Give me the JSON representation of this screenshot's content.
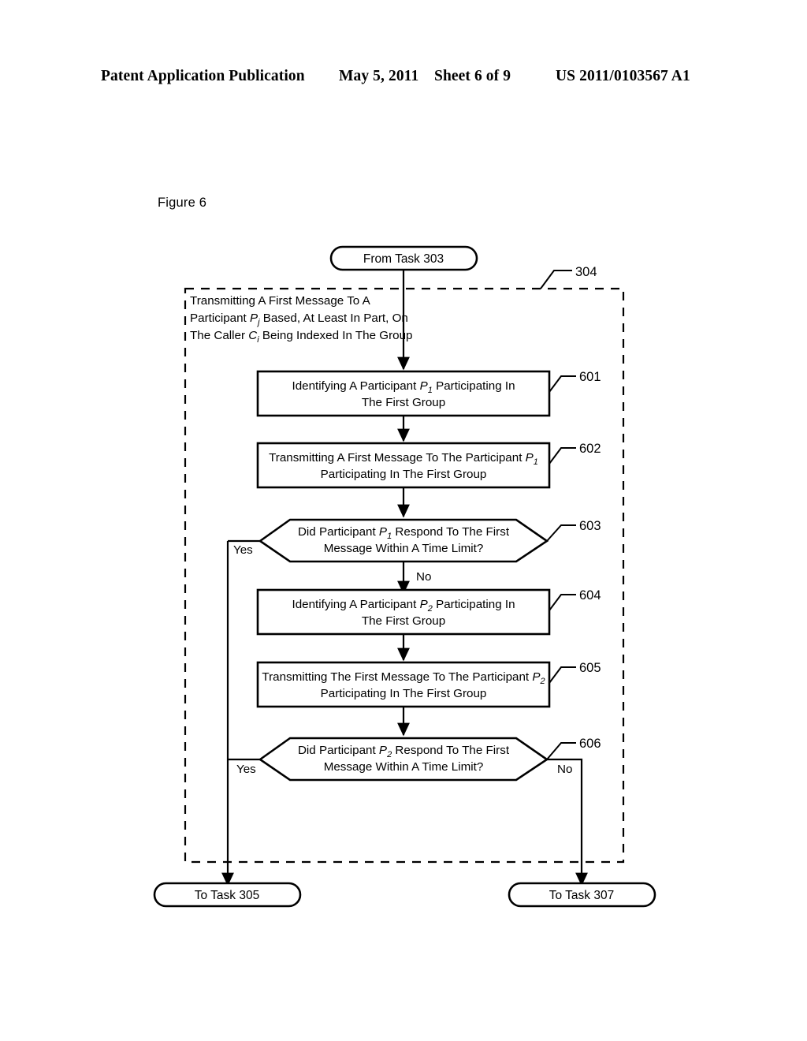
{
  "header": {
    "publication": "Patent Application Publication",
    "date": "May 5, 2011",
    "sheet": "Sheet 6 of 9",
    "number": "US 2011/0103567 A1"
  },
  "figure": {
    "label": "Figure 6"
  },
  "start_terminal": {
    "id": "from-task-303",
    "label": "From Task 303"
  },
  "group_box": {
    "ref": "304",
    "line1": "Transmitting A First Message To A",
    "line2_pre": "Participant ",
    "line2_var": "P",
    "line2_sub": "j",
    "line2_post": " Based, At Least In Part, On",
    "line3_pre": "The Caller ",
    "line3_var": "C",
    "line3_sub": "i",
    "line3_post": " Being Indexed In The Group"
  },
  "steps": [
    {
      "ref": "601",
      "shape": "process",
      "line1_pre": "Identifying A Participant ",
      "line1_var": "P",
      "line1_sub": "1",
      "line1_post": " Participating In",
      "line2": "The First Group"
    },
    {
      "ref": "602",
      "shape": "process",
      "line1_pre": "Transmitting A First Message To The Participant ",
      "line1_var": "P",
      "line1_sub": "1",
      "line1_post": "",
      "line2": "Participating In The First Group"
    },
    {
      "ref": "603",
      "shape": "decision",
      "line1_pre": "Did Participant ",
      "line1_var": "P",
      "line1_sub": "1",
      "line1_post": " Respond To The First",
      "line2": "Message Within A Time Limit?",
      "yes_label": "Yes",
      "no_label": "No"
    },
    {
      "ref": "604",
      "shape": "process",
      "line1_pre": "Identifying A Participant ",
      "line1_var": "P",
      "line1_sub": "2",
      "line1_post": " Participating In",
      "line2": "The First Group"
    },
    {
      "ref": "605",
      "shape": "process",
      "line1_pre": "Transmitting The First Message To The Participant ",
      "line1_var": "P",
      "line1_sub": "2",
      "line1_post": "",
      "line2": "Participating In The First Group"
    },
    {
      "ref": "606",
      "shape": "decision",
      "line1_pre": "Did Participant ",
      "line1_var": "P",
      "line1_sub": "2",
      "line1_post": " Respond To The First",
      "line2": "Message Within A Time Limit?",
      "yes_label": "Yes",
      "no_label": "No"
    }
  ],
  "end_terminals": [
    {
      "id": "to-task-305",
      "label": "To Task 305"
    },
    {
      "id": "to-task-307",
      "label": "To Task 307"
    }
  ]
}
